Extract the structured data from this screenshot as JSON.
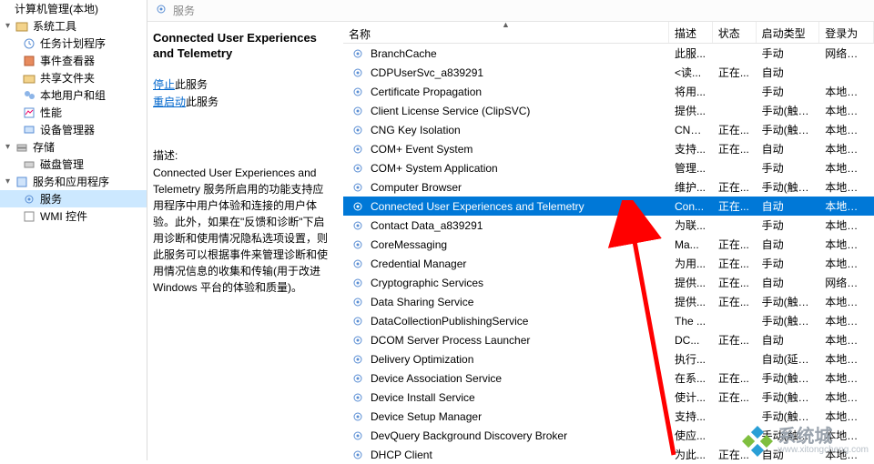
{
  "tree": {
    "root": "计算机管理(本地)",
    "groups": [
      {
        "label": "系统工具",
        "children": [
          "任务计划程序",
          "事件查看器",
          "共享文件夹",
          "本地用户和组",
          "性能",
          "设备管理器"
        ]
      },
      {
        "label": "存储",
        "children": [
          "磁盘管理"
        ]
      },
      {
        "label": "服务和应用程序",
        "children": [
          "服务",
          "WMI 控件"
        ]
      }
    ],
    "selected": "服务"
  },
  "search": {
    "label": "服务"
  },
  "info": {
    "title": "Connected User Experiences and Telemetry",
    "stop_link": "停止",
    "stop_suffix": "此服务",
    "restart_link": "重启动",
    "restart_suffix": "此服务",
    "desc_label": "描述:",
    "desc_body": "Connected User Experiences and Telemetry 服务所启用的功能支持应用程序中用户体验和连接的用户体验。此外，如果在\"反馈和诊断\"下启用诊断和使用情况隐私选项设置，则此服务可以根据事件来管理诊断和使用情况信息的收集和传输(用于改进 Windows 平台的体验和质量)。"
  },
  "columns": {
    "name": "名称",
    "desc": "描述",
    "status": "状态",
    "startup": "启动类型",
    "logon": "登录为"
  },
  "services": [
    {
      "name": "BranchCache",
      "desc": "此服...",
      "status": "",
      "start": "手动",
      "logon": "网络服务"
    },
    {
      "name": "CDPUserSvc_a839291",
      "desc": "<读...",
      "status": "正在...",
      "start": "自动",
      "logon": ""
    },
    {
      "name": "Certificate Propagation",
      "desc": "将用...",
      "status": "",
      "start": "手动",
      "logon": "本地系统"
    },
    {
      "name": "Client License Service (ClipSVC)",
      "desc": "提供...",
      "status": "",
      "start": "手动(触发...",
      "logon": "本地系统"
    },
    {
      "name": "CNG Key Isolation",
      "desc": "CNG...",
      "status": "正在...",
      "start": "手动(触发...",
      "logon": "本地系统"
    },
    {
      "name": "COM+ Event System",
      "desc": "支持...",
      "status": "正在...",
      "start": "自动",
      "logon": "本地服务"
    },
    {
      "name": "COM+ System Application",
      "desc": "管理...",
      "status": "",
      "start": "手动",
      "logon": "本地系统"
    },
    {
      "name": "Computer Browser",
      "desc": "维护...",
      "status": "正在...",
      "start": "手动(触发...",
      "logon": "本地系统"
    },
    {
      "name": "Connected User Experiences and Telemetry",
      "desc": "Con...",
      "status": "正在...",
      "start": "自动",
      "logon": "本地系统",
      "selected": true
    },
    {
      "name": "Contact Data_a839291",
      "desc": "为联...",
      "status": "",
      "start": "手动",
      "logon": "本地系统"
    },
    {
      "name": "CoreMessaging",
      "desc": "Ma...",
      "status": "正在...",
      "start": "自动",
      "logon": "本地服务"
    },
    {
      "name": "Credential Manager",
      "desc": "为用...",
      "status": "正在...",
      "start": "手动",
      "logon": "本地系统"
    },
    {
      "name": "Cryptographic Services",
      "desc": "提供...",
      "status": "正在...",
      "start": "自动",
      "logon": "网络服务"
    },
    {
      "name": "Data Sharing Service",
      "desc": "提供...",
      "status": "正在...",
      "start": "手动(触发...",
      "logon": "本地系统"
    },
    {
      "name": "DataCollectionPublishingService",
      "desc": "The ...",
      "status": "",
      "start": "手动(触发...",
      "logon": "本地系统"
    },
    {
      "name": "DCOM Server Process Launcher",
      "desc": "DC...",
      "status": "正在...",
      "start": "自动",
      "logon": "本地系统"
    },
    {
      "name": "Delivery Optimization",
      "desc": "执行...",
      "status": "",
      "start": "自动(延迟...",
      "logon": "本地系统"
    },
    {
      "name": "Device Association Service",
      "desc": "在系...",
      "status": "正在...",
      "start": "手动(触发...",
      "logon": "本地系统"
    },
    {
      "name": "Device Install Service",
      "desc": "使计...",
      "status": "正在...",
      "start": "手动(触发...",
      "logon": "本地系统"
    },
    {
      "name": "Device Setup Manager",
      "desc": "支持...",
      "status": "",
      "start": "手动(触发...",
      "logon": "本地系统"
    },
    {
      "name": "DevQuery Background Discovery Broker",
      "desc": "使应...",
      "status": "",
      "start": "手动(触发...",
      "logon": "本地系统"
    },
    {
      "name": "DHCP Client",
      "desc": "为此...",
      "status": "正在...",
      "start": "自动",
      "logon": "本地服务"
    }
  ],
  "watermark": {
    "brand": "系统城",
    "url": "www.xitongcheng.com"
  }
}
